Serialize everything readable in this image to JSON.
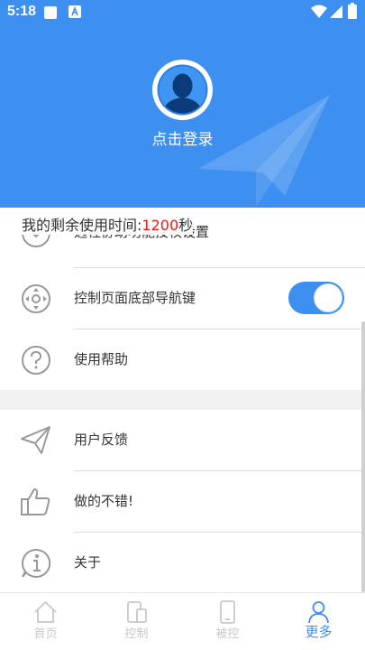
{
  "status": {
    "time": "5:18"
  },
  "header": {
    "login_text": "点击登录"
  },
  "remaining": {
    "prefix": "我的剩余使用时间:",
    "minutes": "1200",
    "unit": "秒"
  },
  "menu": [
    {
      "label": "远程协助功能授权设置",
      "icon": "down-circle-icon"
    },
    {
      "label": "控制页面底部导航键",
      "icon": "navigation-icon",
      "toggle": true
    },
    {
      "label": "使用帮助",
      "icon": "help-icon"
    },
    {
      "label": "用户反馈",
      "icon": "paper-plane-icon"
    },
    {
      "label": "做的不错!",
      "icon": "thumbs-up-icon"
    },
    {
      "label": "关于",
      "icon": "info-icon"
    }
  ],
  "nav": [
    {
      "label": "首页",
      "icon": "home-icon"
    },
    {
      "label": "控制",
      "icon": "devices-icon"
    },
    {
      "label": "被控",
      "icon": "phone-icon"
    },
    {
      "label": "更多",
      "icon": "user-icon",
      "active": true
    }
  ],
  "colors": {
    "primary": "#3d8ff0",
    "accent_red": "#e21c1c",
    "inactive": "#c8c8c8"
  }
}
